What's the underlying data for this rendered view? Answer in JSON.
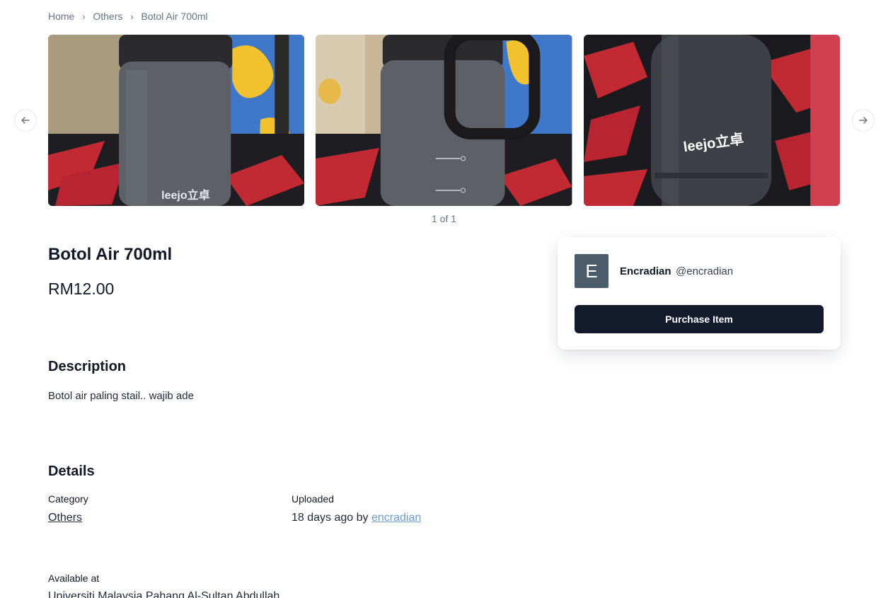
{
  "breadcrumb": {
    "home": "Home",
    "category": "Others",
    "current": "Botol Air 700ml"
  },
  "gallery": {
    "pager": "1 of 1",
    "brand_text": "leejo立卓"
  },
  "product": {
    "title": "Botol Air 700ml",
    "price": "RM12.00"
  },
  "seller": {
    "avatar_initial": "E",
    "name": "Encradian",
    "handle": "@encradian",
    "purchase_label": "Purchase Item"
  },
  "description": {
    "heading": "Description",
    "text": "Botol air paling stail.. wajib ade"
  },
  "details": {
    "heading": "Details",
    "category_label": "Category",
    "category_value": "Others",
    "uploaded_label": "Uploaded",
    "uploaded_prefix": "18 days ago by",
    "uploaded_user": "encradian",
    "available_label": "Available at",
    "available_value": "Universiti Malaysia Pahang Al-Sultan Abdullah"
  }
}
